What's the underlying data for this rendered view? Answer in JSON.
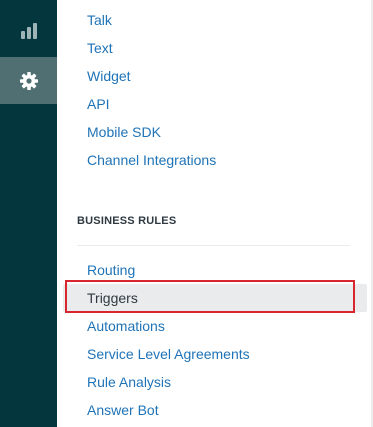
{
  "rail": {
    "items": [
      {
        "icon": "bar-chart-icon"
      },
      {
        "icon": "gear-icon",
        "active": true
      }
    ]
  },
  "channels": {
    "items": [
      "Talk",
      "Text",
      "Widget",
      "API",
      "Mobile SDK",
      "Channel Integrations"
    ]
  },
  "business_rules": {
    "header": "BUSINESS RULES",
    "items": [
      "Routing",
      "Triggers",
      "Automations",
      "Service Level Agreements",
      "Rule Analysis",
      "Answer Bot"
    ],
    "selected": "Triggers"
  },
  "colors": {
    "rail_bg": "#03363d",
    "rail_active_bg": "#4f6f73",
    "link": "#1f73b7",
    "selected_bg": "#e9ebed",
    "highlight_border": "#d9262e"
  }
}
